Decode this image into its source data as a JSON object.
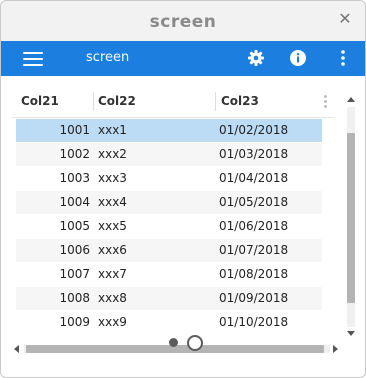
{
  "window": {
    "title": "screen",
    "close_glyph": "✕"
  },
  "appbar": {
    "title": "screen",
    "menu_icon": "hamburger-icon",
    "settings_icon": "gear-icon",
    "info_icon": "info-icon",
    "more_icon": "more-vertical-icon",
    "color": "#1c7fe0"
  },
  "grid": {
    "columns": [
      "Col21",
      "Col22",
      "Col23"
    ],
    "rows": [
      {
        "c1": "1001",
        "c2": "xxx1",
        "c3": "01/02/2018",
        "selected": true
      },
      {
        "c1": "1002",
        "c2": "xxx2",
        "c3": "01/03/2018"
      },
      {
        "c1": "1003",
        "c2": "xxx3",
        "c3": "01/04/2018"
      },
      {
        "c1": "1004",
        "c2": "xxx4",
        "c3": "01/05/2018"
      },
      {
        "c1": "1005",
        "c2": "xxx5",
        "c3": "01/06/2018"
      },
      {
        "c1": "1006",
        "c2": "xxx6",
        "c3": "01/07/2018"
      },
      {
        "c1": "1007",
        "c2": "xxx7",
        "c3": "01/08/2018"
      },
      {
        "c1": "1008",
        "c2": "xxx8",
        "c3": "01/09/2018"
      },
      {
        "c1": "1009",
        "c2": "xxx9",
        "c3": "01/10/2018"
      }
    ],
    "selected_color": "#bcdcf6"
  },
  "pager": {
    "pages": 2,
    "current": 2
  }
}
